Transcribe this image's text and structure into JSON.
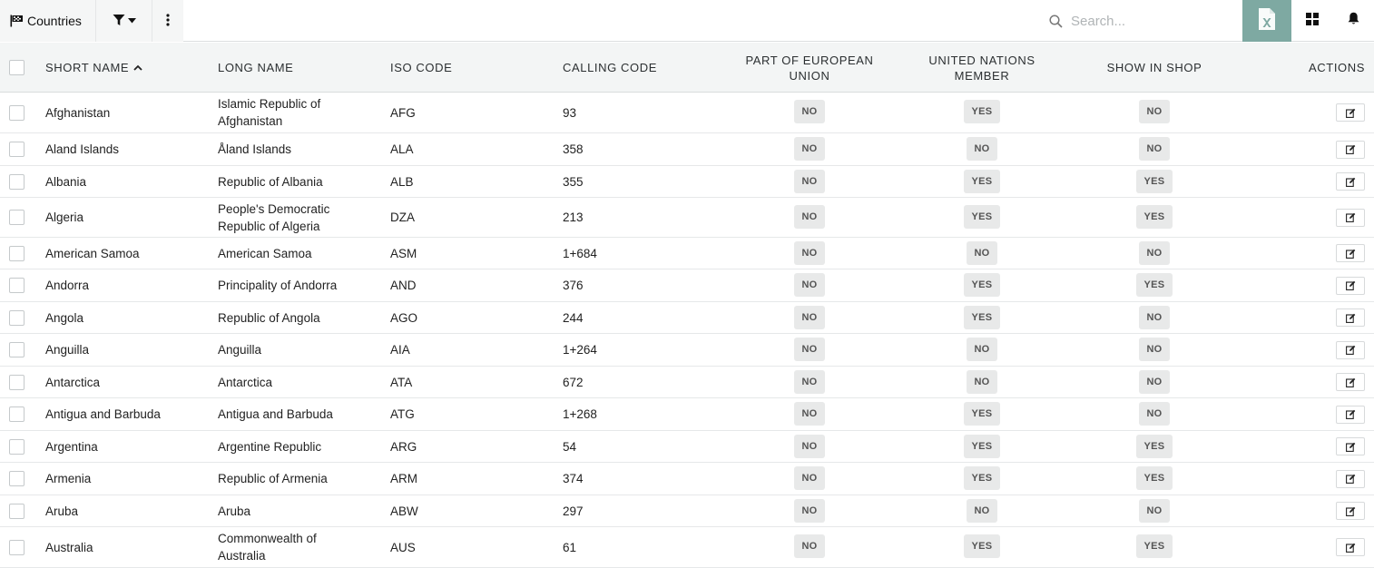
{
  "toolbar": {
    "title": "Countries",
    "search_placeholder": "Search...",
    "icons": {
      "flag": "flag-icon",
      "filter": "filter-icon",
      "more": "more-vertical-icon",
      "excel": "excel-export-icon",
      "grid": "grid-layout-icon",
      "bell": "bell-icon"
    }
  },
  "colors": {
    "excel_button_bg": "#7ea9a2",
    "header_bg": "#f3f5f5",
    "badge_bg": "#e8e9e9"
  },
  "table": {
    "headers": {
      "short_name": "SHORT NAME",
      "long_name": "LONG NAME",
      "iso_code": "ISO CODE",
      "calling_code": "CALLING CODE",
      "eu": "PART OF EUROPEAN UNION",
      "un": "UNITED NATIONS MEMBER",
      "shop": "SHOW IN SHOP",
      "actions": "ACTIONS"
    },
    "sort": {
      "column": "short_name",
      "direction": "ascending"
    },
    "rows": [
      {
        "short": "Afghanistan",
        "long": "Islamic Republic of Afghanistan",
        "iso": "AFG",
        "calling": "93",
        "eu": "NO",
        "un": "YES",
        "shop": "NO"
      },
      {
        "short": "Aland Islands",
        "long": "Åland Islands",
        "iso": "ALA",
        "calling": "358",
        "eu": "NO",
        "un": "NO",
        "shop": "NO"
      },
      {
        "short": "Albania",
        "long": "Republic of Albania",
        "iso": "ALB",
        "calling": "355",
        "eu": "NO",
        "un": "YES",
        "shop": "YES"
      },
      {
        "short": "Algeria",
        "long": "People's Democratic Republic of Algeria",
        "iso": "DZA",
        "calling": "213",
        "eu": "NO",
        "un": "YES",
        "shop": "YES"
      },
      {
        "short": "American Samoa",
        "long": "American Samoa",
        "iso": "ASM",
        "calling": "1+684",
        "eu": "NO",
        "un": "NO",
        "shop": "NO"
      },
      {
        "short": "Andorra",
        "long": "Principality of Andorra",
        "iso": "AND",
        "calling": "376",
        "eu": "NO",
        "un": "YES",
        "shop": "YES"
      },
      {
        "short": "Angola",
        "long": "Republic of Angola",
        "iso": "AGO",
        "calling": "244",
        "eu": "NO",
        "un": "YES",
        "shop": "NO"
      },
      {
        "short": "Anguilla",
        "long": "Anguilla",
        "iso": "AIA",
        "calling": "1+264",
        "eu": "NO",
        "un": "NO",
        "shop": "NO"
      },
      {
        "short": "Antarctica",
        "long": "Antarctica",
        "iso": "ATA",
        "calling": "672",
        "eu": "NO",
        "un": "NO",
        "shop": "NO"
      },
      {
        "short": "Antigua and Barbuda",
        "long": "Antigua and Barbuda",
        "iso": "ATG",
        "calling": "1+268",
        "eu": "NO",
        "un": "YES",
        "shop": "NO"
      },
      {
        "short": "Argentina",
        "long": "Argentine Republic",
        "iso": "ARG",
        "calling": "54",
        "eu": "NO",
        "un": "YES",
        "shop": "YES"
      },
      {
        "short": "Armenia",
        "long": "Republic of Armenia",
        "iso": "ARM",
        "calling": "374",
        "eu": "NO",
        "un": "YES",
        "shop": "YES"
      },
      {
        "short": "Aruba",
        "long": "Aruba",
        "iso": "ABW",
        "calling": "297",
        "eu": "NO",
        "un": "NO",
        "shop": "NO"
      },
      {
        "short": "Australia",
        "long": "Commonwealth of Australia",
        "iso": "AUS",
        "calling": "61",
        "eu": "NO",
        "un": "YES",
        "shop": "YES"
      }
    ]
  }
}
